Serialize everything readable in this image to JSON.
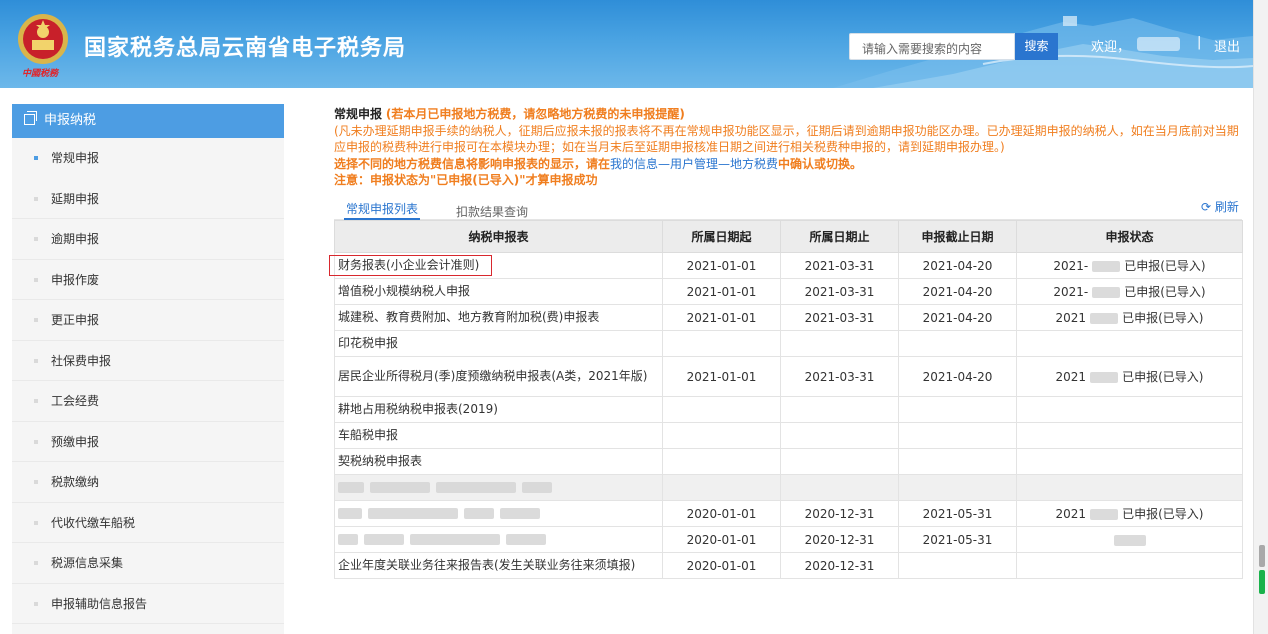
{
  "header": {
    "site_title": "国家税务总局云南省电子税务局",
    "emblem_caption": "中國税務",
    "search_placeholder": "请输入需要搜索的内容",
    "search_button": "搜索",
    "welcome": "欢迎，",
    "separator": "|",
    "logout": "退出"
  },
  "sidebar": {
    "section_label": "申报纳税",
    "items": [
      {
        "label": "常规申报",
        "active": true
      },
      {
        "label": "延期申报"
      },
      {
        "label": "逾期申报"
      },
      {
        "label": "申报作废"
      },
      {
        "label": "更正申报"
      },
      {
        "label": "社保费申报"
      },
      {
        "label": "工会经费"
      },
      {
        "label": "预缴申报"
      },
      {
        "label": "税款缴纳"
      },
      {
        "label": "代收代缴车船税"
      },
      {
        "label": "税源信息采集"
      },
      {
        "label": "申报辅助信息报告"
      }
    ]
  },
  "notice": {
    "title": "常规申报",
    "title_note": "(若本月已申报地方税费，请忽略地方税费的未申报提醒)",
    "line1": "(凡未办理延期申报手续的纳税人，征期后应报未报的报表将不再在常规申报功能区显示，征期后请到逾期申报功能区办理。已办理延期申报的纳税人，如在当月底前对当期应申报的税费种进行申报可在本模块办理；如在当月末后至延期申报核准日期之间进行相关税费种申报的，请到延期申报办理。)",
    "line2_a": "选择不同的地方税费信息将影响申报表的显示，请在",
    "line2_link": "我的信息—用户管理—地方税费",
    "line2_b": "中确认或切换。",
    "line3": "注意：申报状态为\"已申报(已导入)\"才算申报成功"
  },
  "tabs": {
    "active": "常规申报列表",
    "inactive": "扣款结果查询",
    "refresh": "刷新"
  },
  "table": {
    "headers": [
      "纳税申报表",
      "所属日期起",
      "所属日期止",
      "申报截止日期",
      "申报状态"
    ],
    "rows": [
      {
        "name": "财务报表(小企业会计准则)",
        "start": "2021-01-01",
        "end": "2021-03-31",
        "deadline": "2021-04-20",
        "status_prefix": "2021-",
        "status": "已申报(已导入)",
        "highlight": true
      },
      {
        "name": "增值税小规模纳税人申报",
        "start": "2021-01-01",
        "end": "2021-03-31",
        "deadline": "2021-04-20",
        "status_prefix": "2021-",
        "status": "已申报(已导入)"
      },
      {
        "name": "城建税、教育费附加、地方教育附加税(费)申报表",
        "start": "2021-01-01",
        "end": "2021-03-31",
        "deadline": "2021-04-20",
        "status_prefix": "2021",
        "status": "已申报(已导入)"
      },
      {
        "name": "印花税申报",
        "start": "",
        "end": "",
        "deadline": "",
        "status_prefix": "",
        "status": ""
      },
      {
        "name": "居民企业所得税月(季)度预缴纳税申报表(A类，2021年版)",
        "start": "2021-01-01",
        "end": "2021-03-31",
        "deadline": "2021-04-20",
        "status_prefix": "2021",
        "status": "已申报(已导入)",
        "tall": true
      },
      {
        "name": "耕地占用税纳税申报表(2019)",
        "start": "",
        "end": "",
        "deadline": "",
        "status_prefix": "",
        "status": ""
      },
      {
        "name": "车船税申报",
        "start": "",
        "end": "",
        "deadline": "",
        "status_prefix": "",
        "status": ""
      },
      {
        "name": "契税纳税申报表",
        "start": "",
        "end": "",
        "deadline": "",
        "status_prefix": "",
        "status": ""
      },
      {
        "name": "",
        "start": "",
        "end": "",
        "deadline": "",
        "status_prefix": "",
        "status": "",
        "grey": true,
        "blurred": true
      },
      {
        "name": "",
        "start": "2020-01-01",
        "end": "2020-12-31",
        "deadline": "2021-05-31",
        "status_prefix": "2021",
        "status": "已申报(已导入)",
        "blurred": true
      },
      {
        "name": "",
        "start": "2020-01-01",
        "end": "2020-12-31",
        "deadline": "2021-05-31",
        "status_prefix": "",
        "status": "",
        "blurred": true
      },
      {
        "name": "企业年度关联业务往来报告表(发生关联业务往来须填报)",
        "start": "2020-01-01",
        "end": "2020-12-31",
        "deadline": "",
        "status_prefix": "",
        "status": ""
      }
    ]
  },
  "colors": {
    "header_blue": "#2f8ed8",
    "accent_blue": "#2a75cf",
    "orange_notice": "#f07e1f",
    "highlight_red": "#d8282e"
  }
}
